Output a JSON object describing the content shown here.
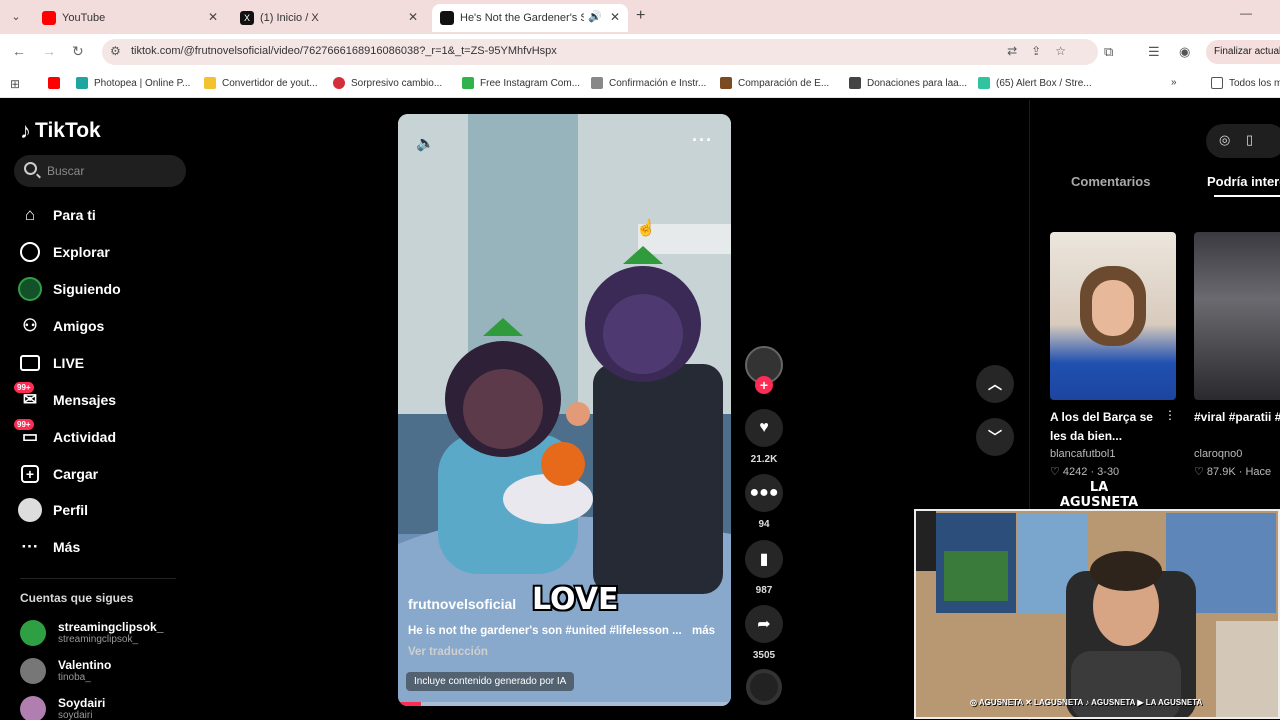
{
  "browser": {
    "tabs": [
      {
        "title": "YouTube",
        "icon": "youtube-icon",
        "color": "#ff0000"
      },
      {
        "title": "(1) Inicio / X",
        "icon": "x-icon",
        "color": "#000000"
      },
      {
        "title": "He's Not the Gardener's Sc",
        "icon": "tiktok-icon",
        "color": "#000000"
      }
    ],
    "url": "tiktok.com/@frutnovelsoficial/video/7627666168916086038?_r=1&_t=ZS-95YMhfvHspx",
    "finalizar": "Finalizar actual",
    "bookmarks": [
      {
        "label": "Photopea | Online P...",
        "color": "#1fa5a0"
      },
      {
        "label": "Convertidor de yout...",
        "color": "#f2c230"
      },
      {
        "label": "Sorpresivo cambio...",
        "color": "#d22f3a"
      },
      {
        "label": "Free Instagram Com...",
        "color": "#30b34a"
      },
      {
        "label": "Confirmación e Instr...",
        "color": "#888888"
      },
      {
        "label": "Comparación de E...",
        "color": "#7a4a20"
      },
      {
        "label": "Donaciones para laa...",
        "color": "#444444"
      },
      {
        "label": "(65) Alert Box / Stre...",
        "color": "#31c3a0"
      }
    ],
    "all_bookmarks": "Todos los m"
  },
  "sidebar": {
    "logo": "TikTok",
    "search_placeholder": "Buscar",
    "nav": [
      {
        "label": "Para ti",
        "icon": "home-icon"
      },
      {
        "label": "Explorar",
        "icon": "compass-icon"
      },
      {
        "label": "Siguiendo",
        "icon": "following-avatar-icon"
      },
      {
        "label": "Amigos",
        "icon": "friends-icon"
      },
      {
        "label": "LIVE",
        "icon": "live-icon"
      },
      {
        "label": "Mensajes",
        "icon": "messages-icon",
        "badge": "99+"
      },
      {
        "label": "Actividad",
        "icon": "activity-icon",
        "badge": "99+"
      },
      {
        "label": "Cargar",
        "icon": "upload-icon"
      },
      {
        "label": "Perfil",
        "icon": "profile-icon"
      },
      {
        "label": "Más",
        "icon": "more-icon"
      }
    ],
    "following_header": "Cuentas que sigues",
    "accounts": [
      {
        "name": "streamingclipsok_",
        "handle": "streamingclipsok_",
        "color": "#2ea043"
      },
      {
        "name": "Valentino",
        "handle": "tinoba_",
        "color": "#777777"
      },
      {
        "name": "Soydairi",
        "handle": "soydairi",
        "color": "#b07fb0"
      }
    ]
  },
  "video": {
    "author": "frutnovelsoficial",
    "caption": "He is not the gardener's son #united #lifelesson ...",
    "more": "más",
    "translate": "Ver traducción",
    "ai_label": "Incluye contenido generado por IA",
    "overlay_text": "LOVE",
    "progress": 0.07
  },
  "actions": {
    "likes": "21.2K",
    "comments": "94",
    "saves": "987",
    "shares": "3505"
  },
  "right_panel": {
    "tab_comments": "Comentarios",
    "tab_suggest": "Podría intere",
    "cards": [
      {
        "title": "A los del Barça se les da bien...",
        "user": "blancafutbol1",
        "stats": "♡ 4242 · 3-30"
      },
      {
        "title": "#viral #paratii #fyp...",
        "user": "claroqno0",
        "stats": "♡ 87.9K · Hace"
      }
    ]
  },
  "webcam": {
    "brand": "LA AGUSNETA",
    "socials": "◎ AGUSNETA  ✕ LAGUSNETA  ♪ AGUSNETA  ▶ LA AGUSNETA"
  },
  "colors": {
    "accent": "#fe2c55",
    "bg": "#000000"
  }
}
